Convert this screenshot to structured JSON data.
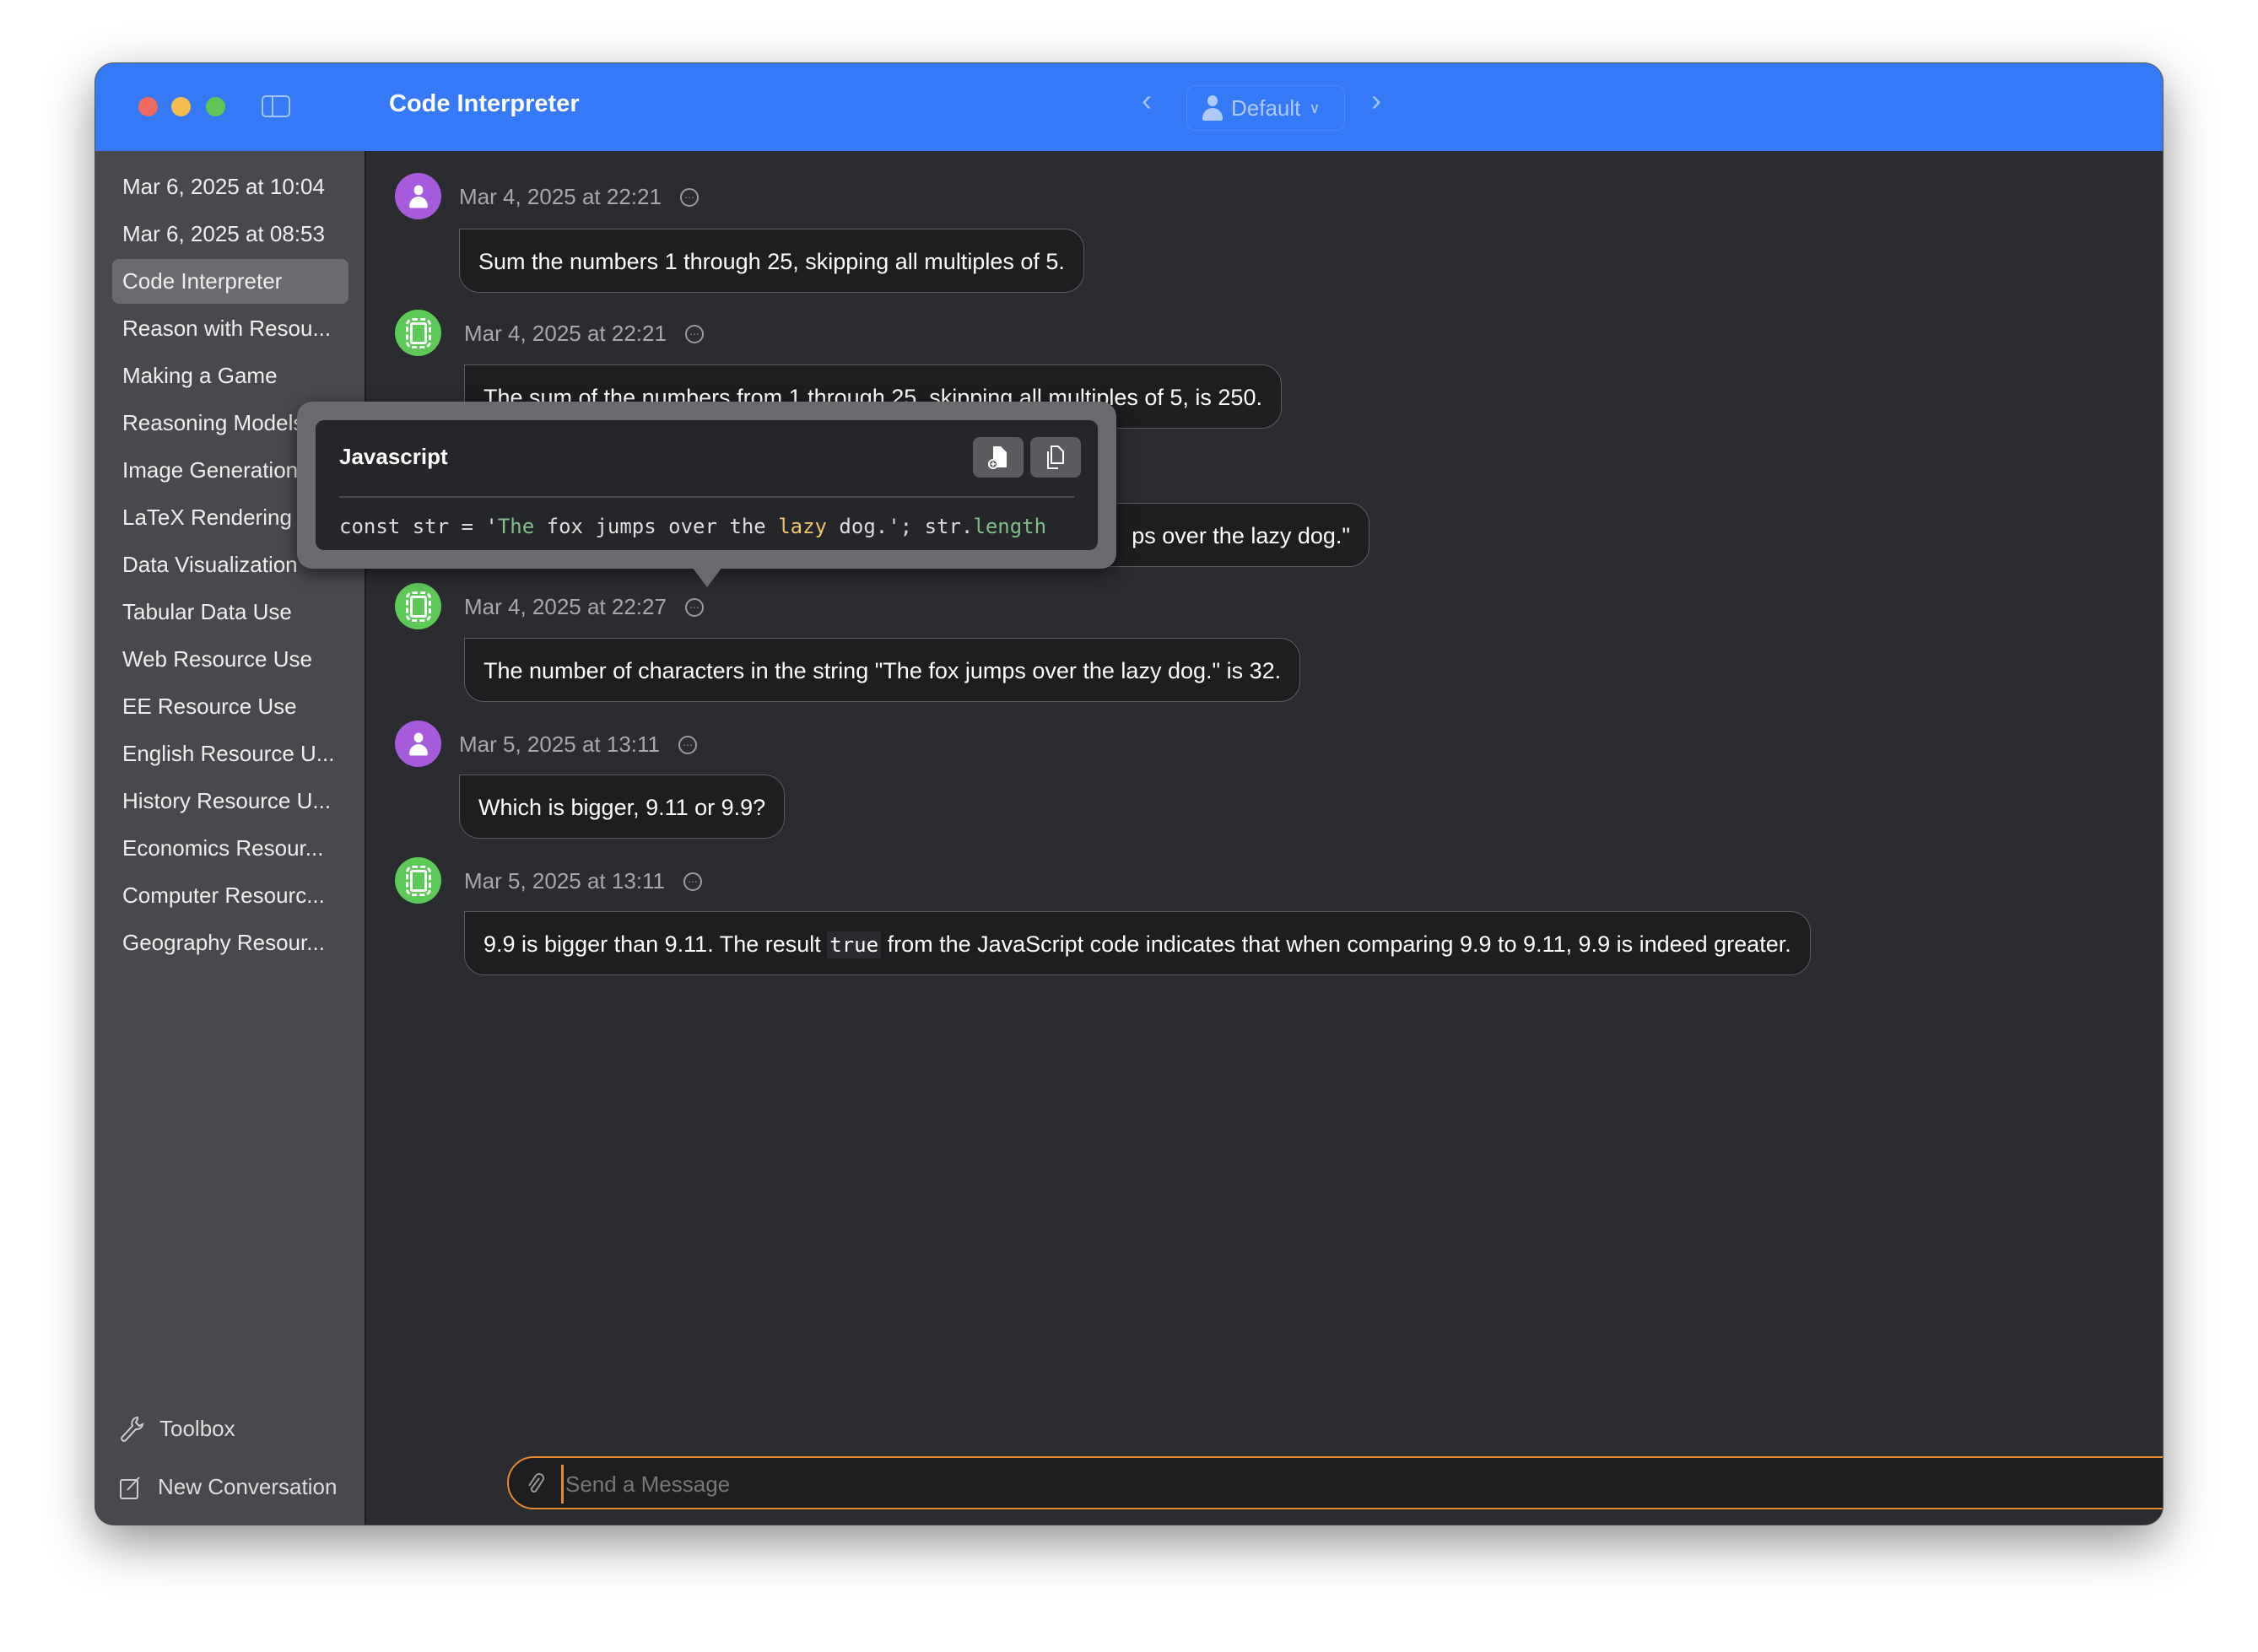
{
  "window": {
    "title": "Code Interpreter"
  },
  "toolbar": {
    "profile": "Default",
    "back_icon": "chevron-left",
    "forward_icon": "chevron-right"
  },
  "sidebar": {
    "items": [
      {
        "label": "Mar 6, 2025 at 10:04"
      },
      {
        "label": "Mar 6, 2025 at 08:53"
      },
      {
        "label": "Code Interpreter",
        "selected": true
      },
      {
        "label": "Reason with Resou..."
      },
      {
        "label": "Making a Game"
      },
      {
        "label": "Reasoning Models"
      },
      {
        "label": "Image Generation"
      },
      {
        "label": "LaTeX Rendering"
      },
      {
        "label": "Data Visualization"
      },
      {
        "label": "Tabular Data Use"
      },
      {
        "label": "Web Resource Use"
      },
      {
        "label": "EE Resource Use"
      },
      {
        "label": "English Resource U..."
      },
      {
        "label": "History Resource U..."
      },
      {
        "label": "Economics Resour..."
      },
      {
        "label": "Computer Resourc..."
      },
      {
        "label": "Geography Resour..."
      }
    ],
    "toolbox": "Toolbox",
    "new_conversation": "New Conversation"
  },
  "messages": [
    {
      "role": "user",
      "timestamp": "Mar 4, 2025 at 22:21",
      "text": "Sum the numbers 1 through 25, skipping all multiples of 5."
    },
    {
      "role": "assistant",
      "timestamp": "Mar 4, 2025 at 22:21",
      "text": "The sum of the numbers from 1 through 25, skipping all multiples of 5, is 250."
    },
    {
      "role": "user",
      "text": "ps over the lazy dog.\""
    },
    {
      "role": "assistant",
      "timestamp": "Mar 4, 2025 at 22:27",
      "text": "The number of characters in the string \"The fox jumps over the lazy dog.\" is 32."
    },
    {
      "role": "user",
      "timestamp": "Mar 5, 2025 at 13:11",
      "text": "Which is bigger, 9.11 or 9.9?"
    },
    {
      "role": "assistant",
      "timestamp": "Mar 5, 2025 at 13:11",
      "text_before": "9.9 is bigger than 9.11. The result",
      "code": "true",
      "text_after": "from the JavaScript code indicates that when comparing 9.9 to 9.11, 9.9 is indeed greater."
    }
  ],
  "code_popover": {
    "language": "Javascript",
    "code_parts": [
      "const str = '",
      "The",
      " fox jumps over the ",
      "lazy",
      " dog.'; str.",
      "length"
    ]
  },
  "composer": {
    "placeholder": "Send a Message",
    "value": ""
  },
  "colors": {
    "accent": "#3579f6",
    "input_border": "#e8892f",
    "user_avatar": "#a55bdc",
    "bot_avatar": "#5dc957"
  }
}
